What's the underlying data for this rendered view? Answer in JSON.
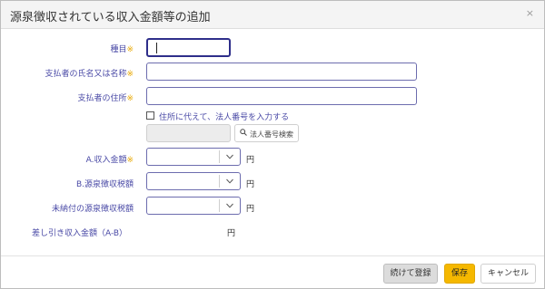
{
  "dialog": {
    "title": "源泉徴収されている収入金額等の追加",
    "close_symbol": "×"
  },
  "form": {
    "required_mark": "※",
    "kind": {
      "label": "種目",
      "value": ""
    },
    "payer_name": {
      "label": "支払者の氏名又は名称",
      "value": ""
    },
    "payer_address": {
      "label": "支払者の住所",
      "value": ""
    },
    "corp_number_option": {
      "label": "住所に代えて、法人番号を入力する",
      "checked": false
    },
    "corp_number": {
      "value": ""
    },
    "corp_search_button": {
      "label": "法人番号検索",
      "icon": "search-icon"
    },
    "income_amount": {
      "label": "A.収入金額",
      "unit": "円",
      "value": ""
    },
    "withholding_tax": {
      "label": "B.源泉徴収税額",
      "unit": "円",
      "value": ""
    },
    "unpaid_withholding": {
      "label": "未納付の源泉徴収税額",
      "unit": "円",
      "value": ""
    },
    "net_income": {
      "label": "差し引き収入金額（A-B）",
      "unit": "円",
      "value": ""
    }
  },
  "footer": {
    "continue_label": "続けて登録",
    "save_label": "保存",
    "cancel_label": "キャンセル"
  },
  "colors": {
    "accent": "#f5b800",
    "label": "#4a4aa6",
    "required": "#e8a800",
    "input_border": "#6c6cae"
  }
}
